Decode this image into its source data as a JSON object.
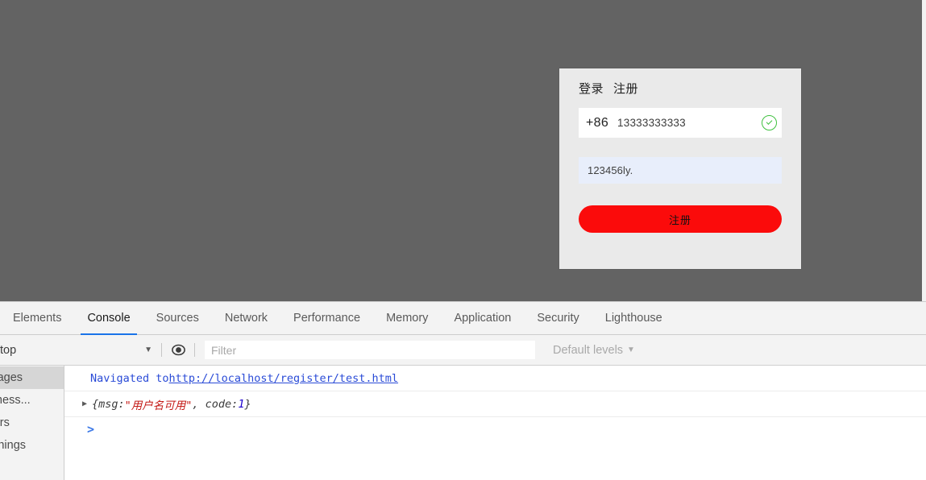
{
  "page": {
    "background_color": "#636363",
    "auth_card": {
      "tabs": [
        {
          "label": "登录",
          "active": false
        },
        {
          "label": "注册",
          "active": true
        }
      ],
      "phone_field": {
        "country_code": "+86",
        "value": "13333333333",
        "placeholder": "",
        "validation_icon": "check-circle-icon",
        "validation_color": "#3ec03e"
      },
      "code_field": {
        "value": "123456ly.",
        "placeholder": "",
        "background_color": "#e8eefb"
      },
      "submit_button": {
        "label": "注册",
        "color": "#fb0b0b"
      }
    }
  },
  "devtools": {
    "tabs": [
      {
        "label": "Elements",
        "active": false
      },
      {
        "label": "Console",
        "active": true
      },
      {
        "label": "Sources",
        "active": false
      },
      {
        "label": "Network",
        "active": false
      },
      {
        "label": "Performance",
        "active": false
      },
      {
        "label": "Memory",
        "active": false
      },
      {
        "label": "Application",
        "active": false
      },
      {
        "label": "Security",
        "active": false
      },
      {
        "label": "Lighthouse",
        "active": false
      }
    ],
    "accent_color": "#1a73e8",
    "toolbar": {
      "context": "top",
      "context_caret": "▼",
      "eye_icon": "eye-icon",
      "filter_placeholder": "Filter",
      "filter_value": "",
      "levels": "Default levels",
      "levels_caret": "▼"
    },
    "sidebar": {
      "items": [
        {
          "label": "essages",
          "full_label": "All messages",
          "selected": true
        },
        {
          "label": "er mess...",
          "full_label": "User messages",
          "selected": false
        },
        {
          "label": "errors",
          "full_label": "No errors",
          "selected": false
        },
        {
          "label": "warnings",
          "full_label": "No warnings",
          "selected": false
        }
      ]
    },
    "console": {
      "messages": [
        {
          "type": "navigation",
          "text": "Navigated to ",
          "url": "http://localhost/register/test.html"
        },
        {
          "type": "object",
          "disclosure": "▶",
          "open_brace": "{msg: ",
          "string_value": "\"用户名可用\"",
          "separator": ", code: ",
          "number_value": "1",
          "close_brace": "}"
        }
      ],
      "prompt_caret": ">",
      "prompt_value": "",
      "prompt_placeholder": ""
    }
  }
}
